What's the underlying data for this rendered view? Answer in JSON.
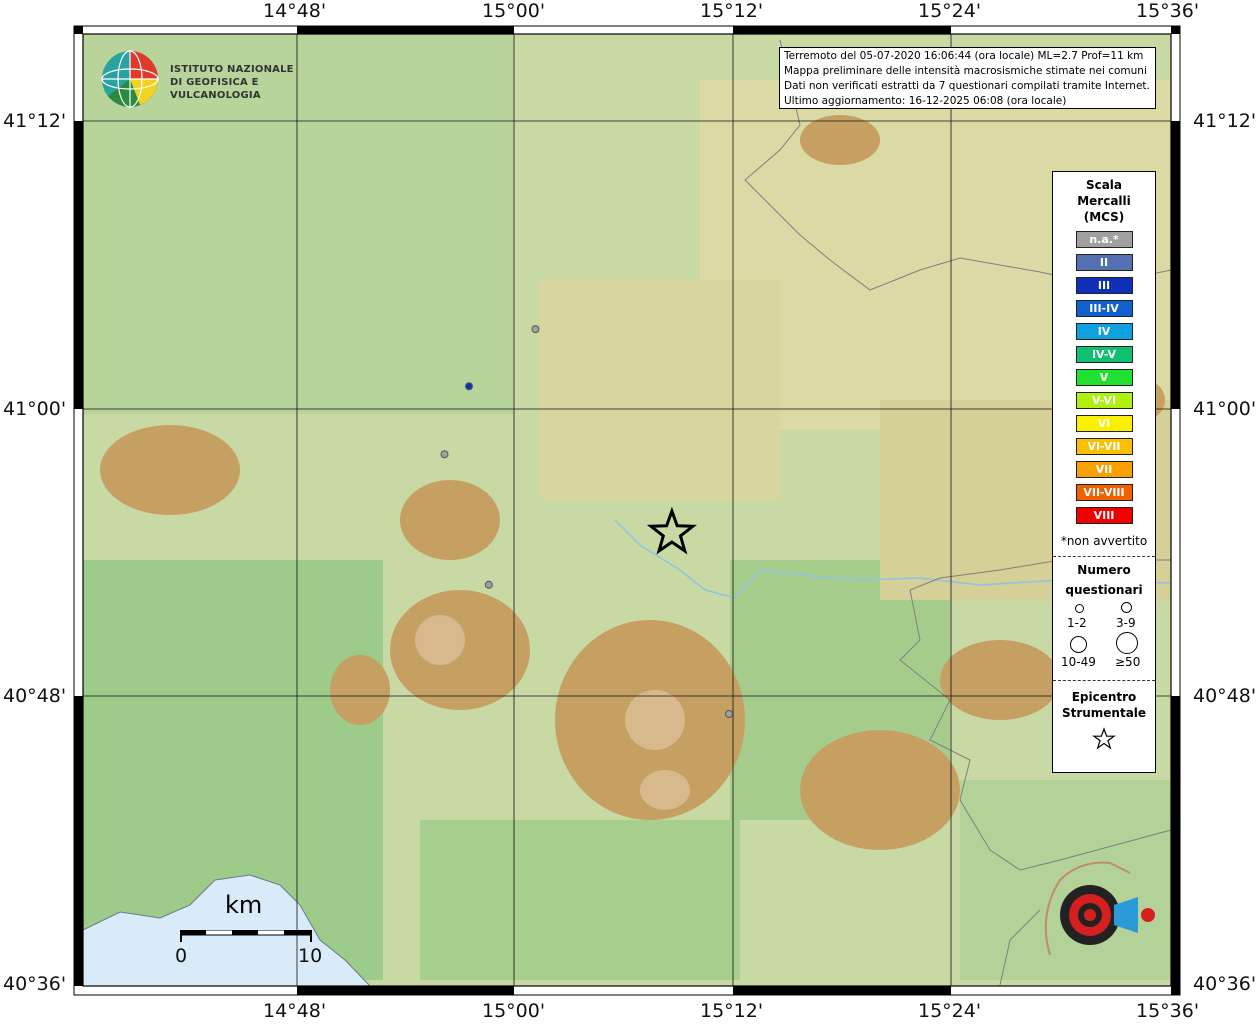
{
  "axes": {
    "top_ticks": [
      "14°48'",
      "15°00'",
      "15°12'",
      "15°24'",
      "15°36'"
    ],
    "bottom_ticks": [
      "14°48'",
      "15°00'",
      "15°12'",
      "15°24'",
      "15°36'"
    ],
    "left_ticks": [
      "41°12'",
      "41°00'",
      "40°48'",
      "40°36'"
    ],
    "right_ticks": [
      "41°12'",
      "41°00'",
      "40°48'",
      "40°36'"
    ]
  },
  "info": {
    "line1": "Terremoto del 05-07-2020 16:06:44 (ora locale) ML=2.7 Prof=11 km",
    "line2": "Mappa preliminare delle intensità macrosismiche stimate nei comuni",
    "line3": "Dati non verificati estratti da 7 questionari compilati tramite Internet.",
    "line4": "Ultimo aggiornamento: 16-12-2025 06:08 (ora locale)"
  },
  "institute": {
    "line1": "ISTITUTO NAZIONALE",
    "line2": "DI GEOFISICA E VULCANOLOGIA"
  },
  "legend": {
    "title_line1": "Scala",
    "title_line2": "Mercalli",
    "title_line3": "(MCS)",
    "classes": [
      {
        "label": "n.a.*",
        "color": "#a0a0a0"
      },
      {
        "label": "II",
        "color": "#5570b0"
      },
      {
        "label": "III",
        "color": "#1030b8"
      },
      {
        "label": "III-IV",
        "color": "#1060d0"
      },
      {
        "label": "IV",
        "color": "#10a0e0"
      },
      {
        "label": "IV-V",
        "color": "#10c070"
      },
      {
        "label": "V",
        "color": "#20e030"
      },
      {
        "label": "V-VI",
        "color": "#b0f010"
      },
      {
        "label": "VI",
        "color": "#f8f000"
      },
      {
        "label": "VI-VII",
        "color": "#f8c000"
      },
      {
        "label": "VII",
        "color": "#f8a000"
      },
      {
        "label": "VII-VIII",
        "color": "#f06000"
      },
      {
        "label": "VIII",
        "color": "#f00000"
      }
    ],
    "note": "*non avvertito",
    "count_title_line1": "Numero",
    "count_title_line2": "questionari",
    "count_labels": [
      "1-2",
      "3-9",
      "10-49",
      "≥50"
    ],
    "epicenter_line1": "Epicentro",
    "epicenter_line2": "Strumentale"
  },
  "scale": {
    "unit": "km",
    "min_label": "0",
    "max_label": "10"
  },
  "observations": [
    {
      "lon": 15.015,
      "lat": 40.895,
      "intensity": "n.a.*",
      "color": "#a0a0a0"
    },
    {
      "lon": 15.055,
      "lat": 41.083,
      "intensity": "n.a.*",
      "color": "#a0a0a0"
    },
    {
      "lon": 14.977,
      "lat": 40.991,
      "intensity": "n.a.*",
      "color": "#a0a0a0"
    },
    {
      "lon": 15.221,
      "lat": 40.8,
      "intensity": "n.a.*",
      "color": "#a0a0a0"
    },
    {
      "lon": 14.998,
      "lat": 41.041,
      "intensity": "III",
      "color": "#1030b8"
    }
  ],
  "epicenter": {
    "lon": 15.172,
    "lat": 40.933
  },
  "bounds": {
    "lon_min": 14.667,
    "lon_max": 15.6,
    "lat_min": 40.6,
    "lat_max": 41.3
  }
}
